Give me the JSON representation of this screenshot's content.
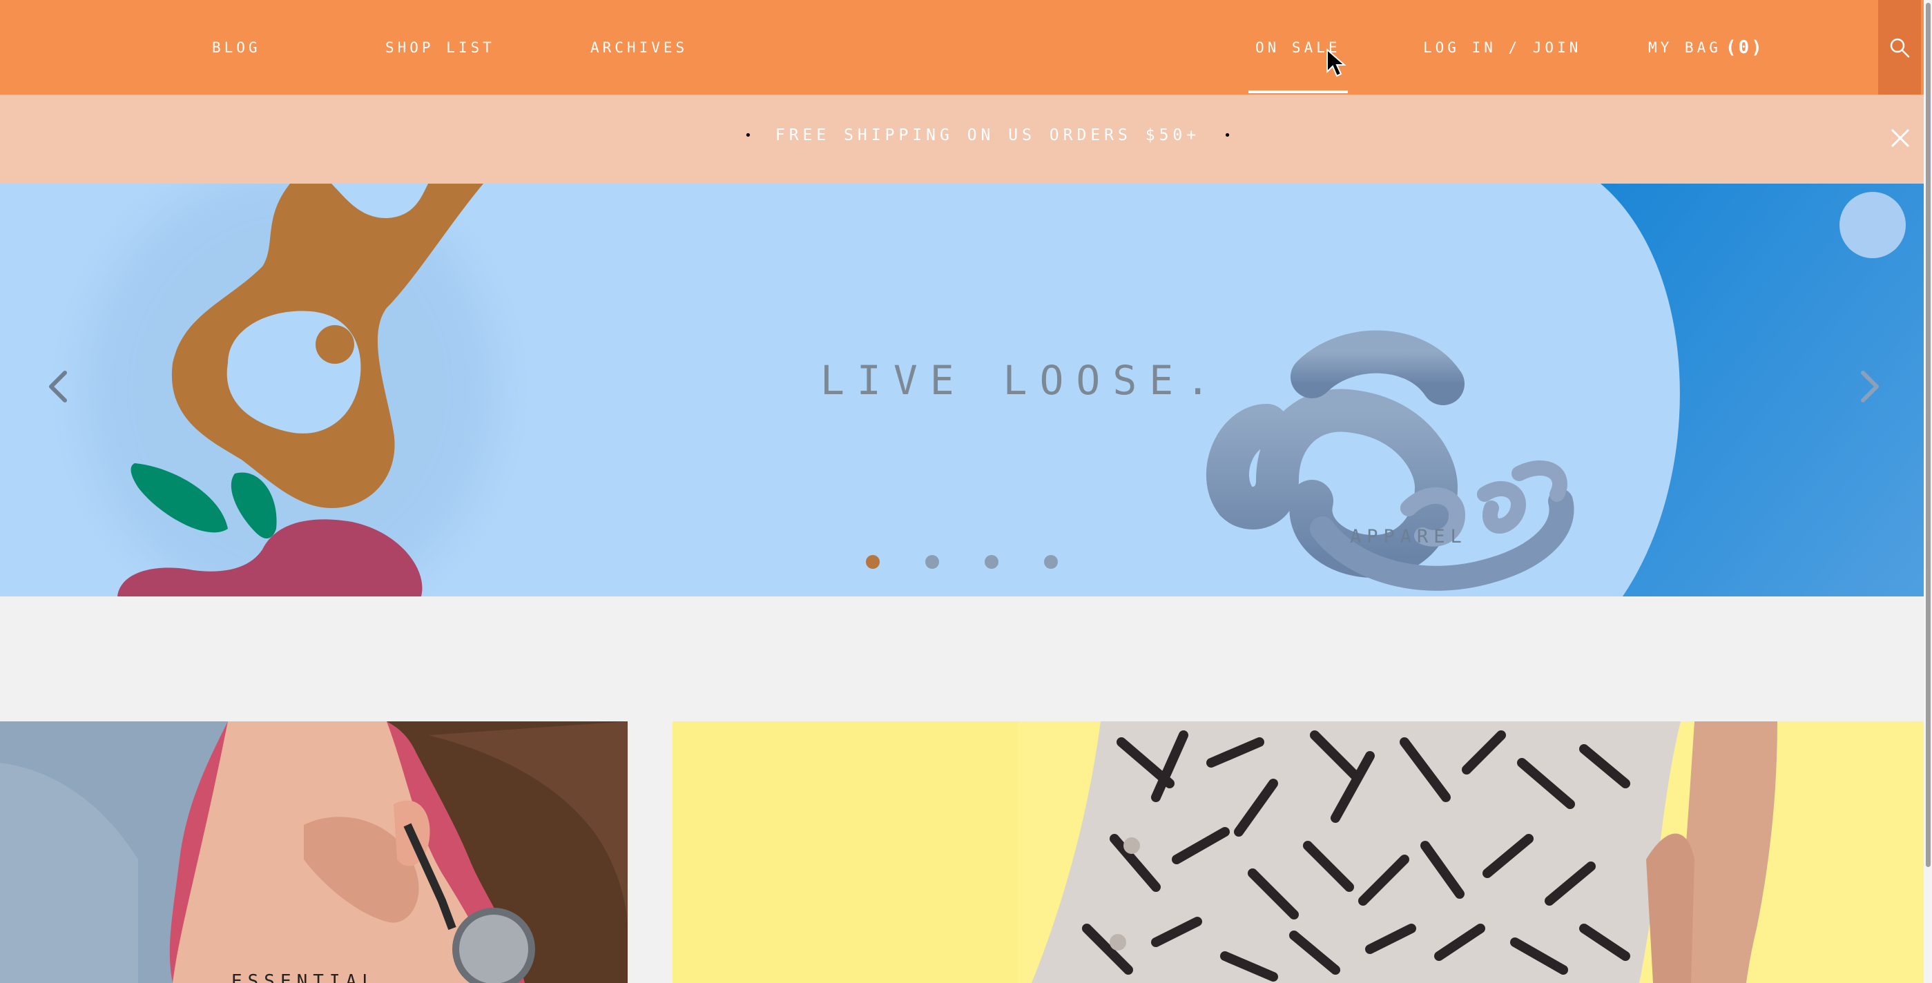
{
  "nav": {
    "links": [
      {
        "label": "BLOG"
      },
      {
        "label": "SHOP LIST"
      },
      {
        "label": "ARCHIVES"
      },
      {
        "label": "ON SALE"
      },
      {
        "label": "LOG IN / JOIN"
      }
    ],
    "bag": {
      "label": "MY BAG",
      "count": "(0)"
    },
    "search_icon": "search-icon",
    "background": "#f5904f"
  },
  "promo": {
    "text": "FREE SHIPPING ON US ORDERS $50+",
    "bullet": "•",
    "close_icon": "close-icon",
    "background": "#f3c6ae"
  },
  "hero": {
    "tagline": "LIVE LOOSE.",
    "brand_sub": "APPAREL",
    "prev_icon": "chevron-left-icon",
    "next_icon": "chevron-right-icon",
    "slides_total": 4,
    "active_slide": 1,
    "background": "#b0d7fa"
  },
  "tiles": [
    {
      "caption": "ESSENTIAL"
    },
    {
      "caption": ""
    }
  ]
}
